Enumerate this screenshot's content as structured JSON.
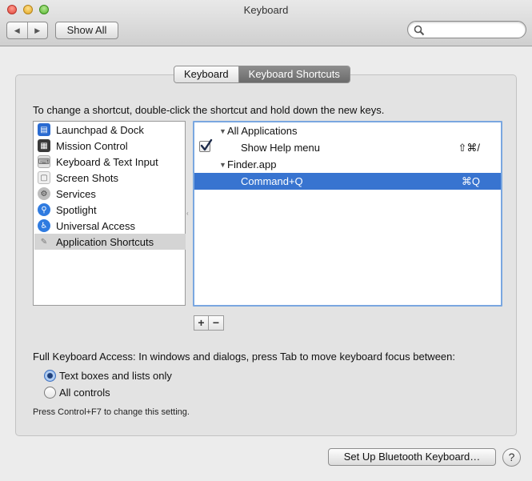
{
  "window": {
    "title": "Keyboard"
  },
  "toolbar": {
    "back_icon": "chevron-left-icon",
    "forward_icon": "chevron-right-icon",
    "show_all_label": "Show All",
    "search_placeholder": ""
  },
  "tabs": [
    {
      "label": "Keyboard",
      "selected": false
    },
    {
      "label": "Keyboard Shortcuts",
      "selected": true
    }
  ],
  "instructions": "To change a shortcut, double-click the shortcut and hold down the new keys.",
  "categories": [
    {
      "label": "Launchpad & Dock",
      "icon": "launchpad-icon",
      "color": "#2a6bd1"
    },
    {
      "label": "Mission Control",
      "icon": "mission-control-icon",
      "color": "#3a3a3a"
    },
    {
      "label": "Keyboard & Text Input",
      "icon": "keyboard-icon",
      "color": "#b0b0b0"
    },
    {
      "label": "Screen Shots",
      "icon": "screenshot-icon",
      "color": "#c9c9c9"
    },
    {
      "label": "Services",
      "icon": "gear-icon",
      "color": "#8a8a8a"
    },
    {
      "label": "Spotlight",
      "icon": "spotlight-icon",
      "color": "#2f7be0"
    },
    {
      "label": "Universal Access",
      "icon": "accessibility-icon",
      "color": "#2f7be0"
    },
    {
      "label": "Application Shortcuts",
      "icon": "app-shortcuts-icon",
      "color": "#9a9a9a",
      "selected": true
    }
  ],
  "shortcuts": [
    {
      "label": "All Applications",
      "type": "group"
    },
    {
      "label": "Show Help menu",
      "type": "item",
      "checked": true,
      "key": "⇧⌘/"
    },
    {
      "label": "Finder.app",
      "type": "group"
    },
    {
      "label": "Command+Q",
      "type": "item",
      "key": "⌘Q",
      "selected": true
    }
  ],
  "buttons": {
    "add": "+",
    "remove": "−"
  },
  "full_keyboard_access": {
    "label": "Full Keyboard Access: In windows and dialogs, press Tab to move keyboard focus between:",
    "options": [
      {
        "label": "Text boxes and lists only",
        "selected": true
      },
      {
        "label": "All controls",
        "selected": false
      }
    ],
    "hint": "Press Control+F7 to change this setting."
  },
  "footer": {
    "bluetooth_label": "Set Up Bluetooth Keyboard…",
    "help_label": "?"
  }
}
